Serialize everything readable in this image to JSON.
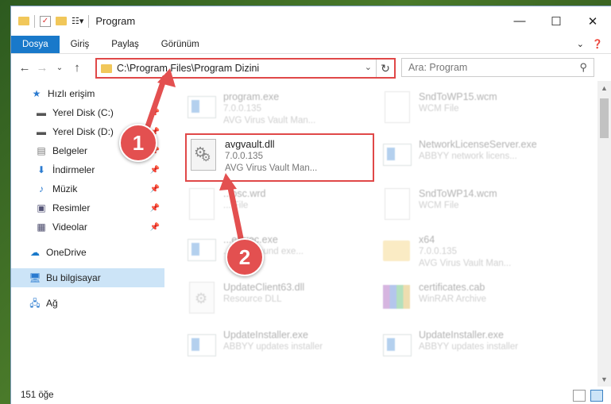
{
  "window": {
    "title": "Program"
  },
  "ribbon": {
    "tabs": [
      "Dosya",
      "Giriş",
      "Paylaş",
      "Görünüm"
    ]
  },
  "address": {
    "path": "C:\\Program Files\\Program Dizini"
  },
  "search": {
    "placeholder": "Ara: Program"
  },
  "sidebar": {
    "items": [
      {
        "label": "Hızlı erişim",
        "icon": "star-icon"
      },
      {
        "label": "Yerel Disk (C:)",
        "icon": "drive-icon"
      },
      {
        "label": "Yerel Disk (D:)",
        "icon": "drive-icon"
      },
      {
        "label": "Belgeler",
        "icon": "documents-icon"
      },
      {
        "label": "İndirmeler",
        "icon": "download-icon"
      },
      {
        "label": "Müzik",
        "icon": "music-icon"
      },
      {
        "label": "Resimler",
        "icon": "pictures-icon"
      },
      {
        "label": "Videolar",
        "icon": "video-icon"
      },
      {
        "label": "OneDrive",
        "icon": "cloud-icon"
      },
      {
        "label": "Bu bilgisayar",
        "icon": "computer-icon"
      },
      {
        "label": "Ağ",
        "icon": "network-icon"
      }
    ]
  },
  "files": [
    {
      "name": "program.exe",
      "line2": "7.0.0.135",
      "line3": "AVG Virus Vault Man..."
    },
    {
      "name": "SndToWP15.wcm",
      "line2": "WCM File",
      "line3": ""
    },
    {
      "name": "avgvault.dll",
      "line2": "7.0.0.135",
      "line3": "AVG Virus Vault Man..."
    },
    {
      "name": "NetworkLicenseServer.exe",
      "line2": "ABBYY network licens...",
      "line3": ""
    },
    {
      "name": "...osc.wrd",
      "line2": "... File",
      "line3": ""
    },
    {
      "name": "SndToWP14.wcm",
      "line2": "WCM File",
      "line3": ""
    },
    {
      "name": "...eExec.exe",
      "line2": "...background exe...",
      "line3": ""
    },
    {
      "name": "x64",
      "line2": "7.0.0.135",
      "line3": "AVG Virus Vault Man..."
    },
    {
      "name": "UpdateClient63.dll",
      "line2": "Resource DLL",
      "line3": ""
    },
    {
      "name": "certificates.cab",
      "line2": "WinRAR Archive",
      "line3": ""
    },
    {
      "name": "UpdateInstaller.exe",
      "line2": "ABBYY updates installer",
      "line3": ""
    },
    {
      "name": "UpdateInstaller.exe",
      "line2": "ABBYY updates installer",
      "line3": ""
    }
  ],
  "status": {
    "count": "151 öğe"
  },
  "callouts": {
    "one": "1",
    "two": "2"
  },
  "colors": {
    "accent": "#1979ca",
    "highlight": "#e04848"
  }
}
